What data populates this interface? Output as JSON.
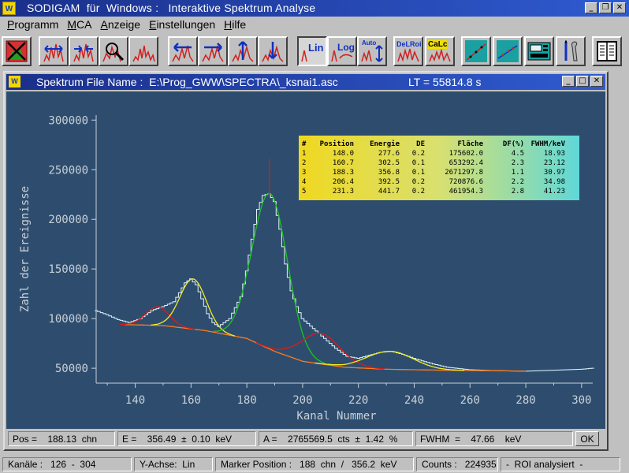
{
  "window": {
    "title": "SODIGAM  für  Windows :   Interaktive Spektrum Analyse",
    "icon_text": "W"
  },
  "menu": [
    {
      "label": "Programm",
      "underline": "P"
    },
    {
      "label": "MCA",
      "underline": "M"
    },
    {
      "label": "Anzeige",
      "underline": "A"
    },
    {
      "label": "Einstellungen",
      "underline": "E"
    },
    {
      "label": "Hilfe",
      "underline": "H"
    }
  ],
  "toolbar": {
    "lin_label": "Lin",
    "log_label": "Log",
    "auto_label": "Auto",
    "delroi_label": "DeLRoi",
    "calc_label": "CaLc"
  },
  "child": {
    "title": "Spektrum File Name :  E:\\Prog_GWW\\SPECTRA\\_ksnai1.asc",
    "live_time": "LT = 55814.8 s"
  },
  "colors": {
    "plot_bg": "#2e4d6e",
    "spectrum": "#dff4ff",
    "fit_total": "#9fe6ff",
    "background_fit": "#ff7a1a",
    "peak_red": "#e01818",
    "peak_yellow": "#f2ee20",
    "peak_green": "#1ec41e",
    "axis": "#c8d0d8"
  },
  "results": {
    "headers": [
      "#",
      "Position",
      "Energie",
      "DE",
      "Fläche",
      "DF(%)",
      "FWHM/keV"
    ],
    "rows": [
      [
        "1",
        "148.0",
        "277.6",
        "0.2",
        "175602.0",
        "4.5",
        "18.93"
      ],
      [
        "2",
        "160.7",
        "302.5",
        "0.1",
        "653292.4",
        "2.3",
        "23.12"
      ],
      [
        "3",
        "188.3",
        "356.8",
        "0.1",
        "2671297.8",
        "1.1",
        "30.97"
      ],
      [
        "4",
        "206.4",
        "392.5",
        "0.2",
        "720876.6",
        "2.2",
        "34.98"
      ],
      [
        "5",
        "231.3",
        "441.7",
        "0.2",
        "461954.3",
        "2.8",
        "41.23"
      ]
    ]
  },
  "chart_data": {
    "type": "line",
    "xlabel": "Kanal Nummer",
    "ylabel": "Zahl der Ereignisse",
    "xlim": [
      126,
      304
    ],
    "ylim": [
      35000,
      305000
    ],
    "x_ticks": [
      140,
      160,
      180,
      200,
      220,
      240,
      260,
      280,
      300
    ],
    "y_ticks": [
      50000,
      100000,
      150000,
      200000,
      250000,
      300000
    ],
    "marker_channel": 188.13,
    "background": {
      "x": [
        136,
        150,
        165,
        180,
        190,
        200,
        215,
        230,
        250,
        270,
        280
      ],
      "y": [
        94000,
        93000,
        88000,
        80000,
        67000,
        57000,
        51000,
        49000,
        48000,
        47500,
        47000
      ]
    },
    "peaks": [
      {
        "center": 148.0,
        "height": 112000,
        "sigma": 4.2,
        "color": "red"
      },
      {
        "center": 160.7,
        "height": 140000,
        "sigma": 4.7,
        "color": "yellow"
      },
      {
        "center": 188.3,
        "height": 226000,
        "sigma": 6.3,
        "color": "green"
      },
      {
        "center": 206.4,
        "height": 85000,
        "sigma": 7.2,
        "color": "red"
      },
      {
        "center": 231.3,
        "height": 67000,
        "sigma": 8.4,
        "color": "yellow"
      }
    ],
    "spectrum": {
      "x": [
        126,
        130,
        134,
        138,
        142,
        146,
        150,
        154,
        156,
        158,
        160,
        162,
        164,
        166,
        168,
        170,
        174,
        178,
        180,
        182,
        184,
        186,
        188,
        190,
        192,
        194,
        196,
        198,
        200,
        204,
        208,
        212,
        216,
        220,
        224,
        228,
        232,
        236,
        240,
        246,
        252,
        260,
        270,
        280,
        290,
        300,
        304
      ],
      "y": [
        108000,
        104000,
        99000,
        96000,
        100000,
        108000,
        112000,
        117000,
        126000,
        136000,
        140000,
        134000,
        120000,
        105000,
        96000,
        92000,
        100000,
        122000,
        148000,
        180000,
        210000,
        224000,
        226000,
        218000,
        190000,
        155000,
        128000,
        112000,
        100000,
        90000,
        80000,
        70000,
        62000,
        60000,
        63000,
        66000,
        67000,
        64000,
        60000,
        55000,
        51000,
        48500,
        47500,
        47000,
        48000,
        49000,
        50000
      ]
    }
  },
  "status": {
    "pos": "Pos =    188.13  chn",
    "energy": "E =    356.49  ±  0.10  keV",
    "area": "A =    2765569.5  cts  ±  1.42  %",
    "fwhm": "FWHM  =    47.66    keV",
    "ok": "OK"
  },
  "bottom": {
    "channels": "Kanäle :   126  -  304",
    "yaxis": "Y-Achse:  Lin",
    "marker": "Marker Position :   188  chn  /   356.2  keV",
    "counts": "Counts :   224935",
    "roi": "-  ROI analysiert  -"
  }
}
